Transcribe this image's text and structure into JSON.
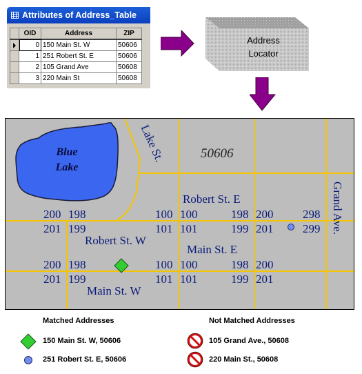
{
  "table_window": {
    "title": "Attributes of Address_Table",
    "columns": [
      "OID",
      "Address",
      "ZIP"
    ],
    "rows": [
      {
        "oid": "0",
        "address": "150 Main St. W",
        "zip": "50606",
        "current": true
      },
      {
        "oid": "1",
        "address": "251 Robert St. E",
        "zip": "50606",
        "current": false
      },
      {
        "oid": "2",
        "address": "105 Grand Ave",
        "zip": "50608",
        "current": false
      },
      {
        "oid": "3",
        "address": "220 Main St",
        "zip": "50608",
        "current": false
      }
    ]
  },
  "locator": {
    "line1": "Address",
    "line2": "Locator"
  },
  "colors": {
    "arrow": "#8b008b",
    "road": "#f5c400",
    "lake": "#3a66f0",
    "matched_diamond": "#33cc33",
    "matched_circle": "#6f8ff0",
    "label_text": "#0a1a78",
    "no_symbol": "#d01010"
  },
  "map": {
    "lake_label_1": "Blue",
    "lake_label_2": "Lake",
    "zip_label": "50606",
    "streets": {
      "lake": "Lake St.",
      "grand": "Grand Ave.",
      "robert_e": "Robert St. E",
      "robert_w": "Robert St. W",
      "main_e": "Main St. E",
      "main_w": "Main St. W"
    },
    "address_ranges": {
      "robert_row_top": [
        "200",
        "198",
        "100",
        "100",
        "198",
        "200",
        "298"
      ],
      "robert_row_bottom": [
        "201",
        "199",
        "101",
        "101",
        "199",
        "201",
        "299"
      ],
      "main_row_top": [
        "200",
        "198",
        "100",
        "100",
        "198",
        "200"
      ],
      "main_row_bottom": [
        "201",
        "199",
        "101",
        "101",
        "199",
        "201"
      ]
    }
  },
  "legend": {
    "matched_title": "Matched Addresses",
    "matched": [
      "150 Main St. W, 50606",
      "251 Robert St. E, 50606"
    ],
    "not_matched_title": "Not Matched Addresses",
    "not_matched": [
      "105 Grand Ave., 50608",
      "220 Main St., 50608"
    ]
  }
}
